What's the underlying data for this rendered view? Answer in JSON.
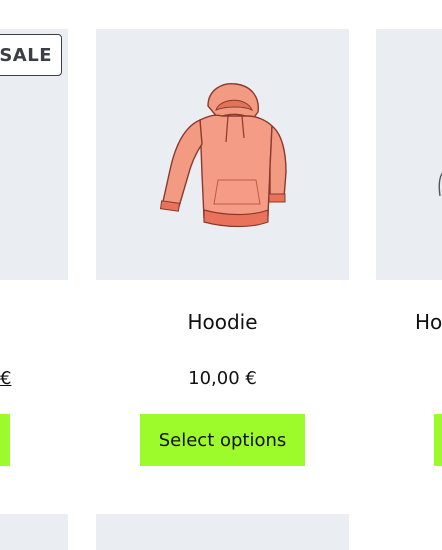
{
  "sale_badge": "SALE",
  "products": [
    {
      "title": "",
      "price": "€",
      "button": ""
    },
    {
      "title": "Hoodie",
      "price": "10,00 €",
      "button": "Select options",
      "image": "hoodie-image"
    },
    {
      "title": "Ho",
      "price": "",
      "button": ""
    }
  ],
  "colors": {
    "button_bg": "#9dfa2b",
    "image_bg": "#eaeef3",
    "hoodie": "#f39a82"
  }
}
